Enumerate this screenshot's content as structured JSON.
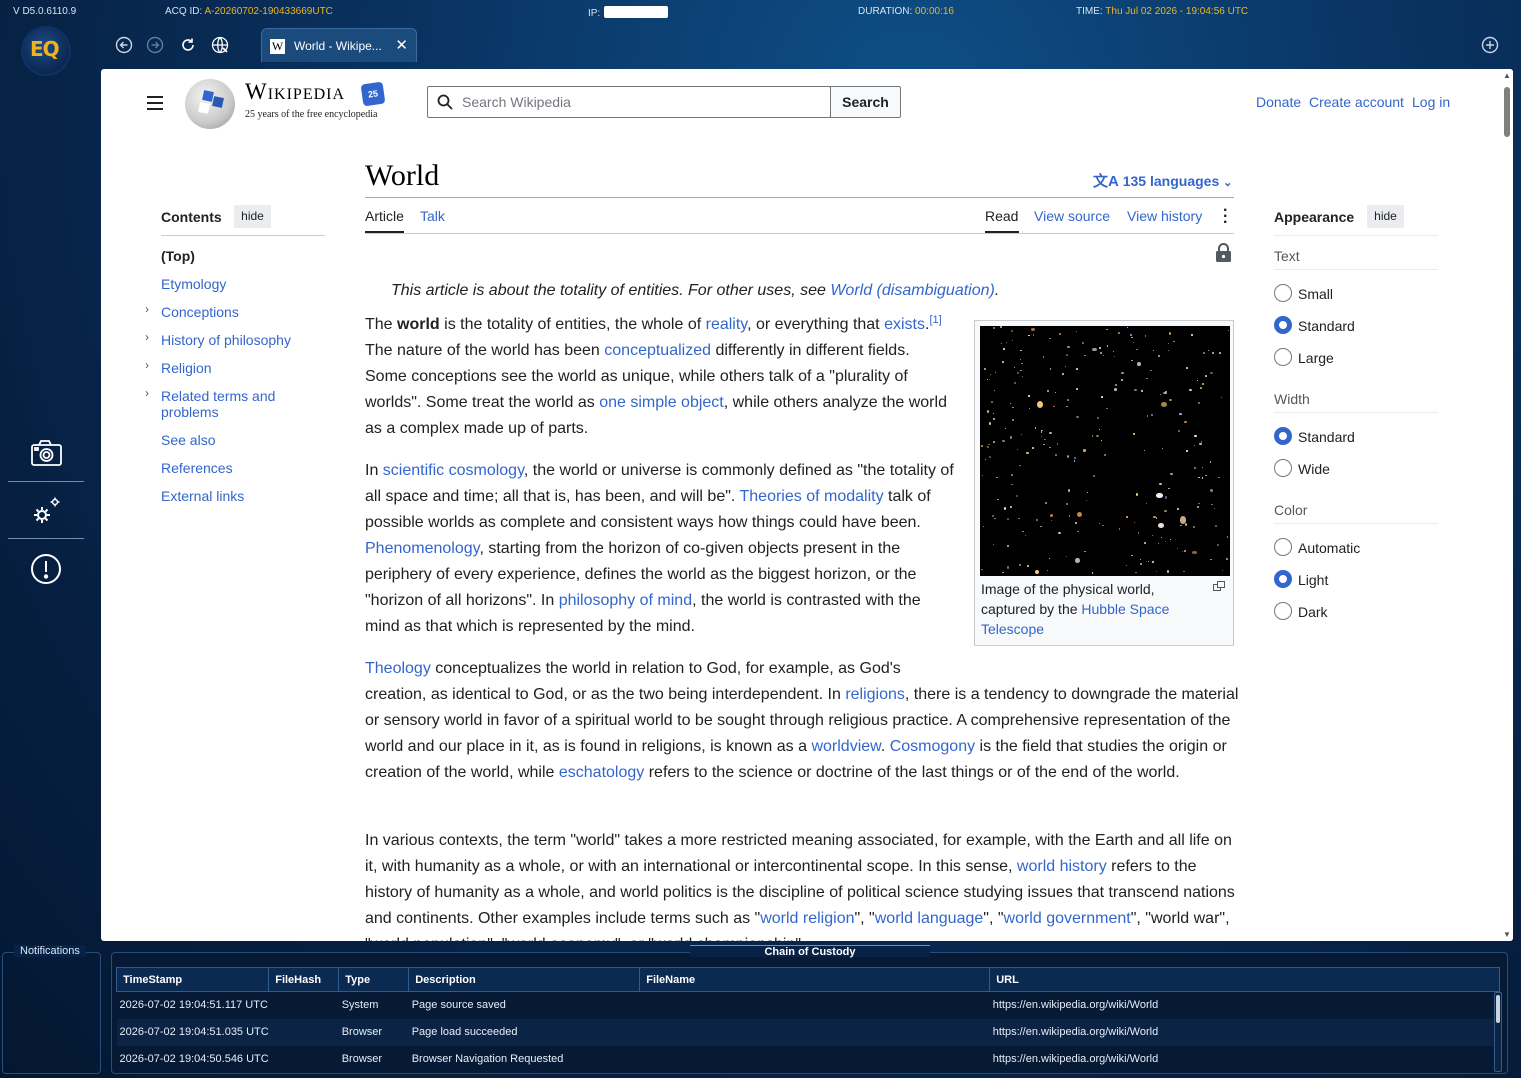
{
  "statusbar": {
    "version": "V D5.0.6110.9",
    "acq_label": "ACQ ID:",
    "acq_value": "A-20260702-190433669UTC",
    "ip_label": "IP:",
    "duration_label": "DURATION:",
    "duration_value": "00:00:16",
    "time_label": "TIME:",
    "time_value": "Thu Jul 02 2026 - 19:04:56 UTC"
  },
  "app": {
    "logo_text": "EQ"
  },
  "browser": {
    "tab_title": "World - Wikipe...",
    "tab_icon": "W",
    "close_glyph": "✕"
  },
  "wiki": {
    "wordmark": "Wikipedia",
    "tagline": "25 years of the free encyclopedia",
    "badge": "25",
    "search_placeholder": "Search Wikipedia",
    "search_button": "Search",
    "donate": "Donate",
    "create_account": "Create account",
    "log_in": "Log in"
  },
  "toc": {
    "heading": "Contents",
    "hide": "hide",
    "items": [
      "(Top)",
      "Etymology",
      "Conceptions",
      "History of philosophy",
      "Religion",
      "Related terms and problems",
      "See also",
      "References",
      "External links"
    ]
  },
  "article": {
    "title": "World",
    "languages": "135 languages",
    "tabs": {
      "article": "Article",
      "talk": "Talk",
      "read": "Read",
      "view_source": "View source",
      "view_history": "View history"
    },
    "hatnote_text": "This article is about the totality of entities. For other uses, see ",
    "hatnote_link": "World (disambiguation)",
    "hatnote_end": ".",
    "caption_a": "Image of the physical world, captured by the ",
    "caption_link": "Hubble Space Telescope"
  },
  "appearance": {
    "heading": "Appearance",
    "hide": "hide",
    "text_label": "Text",
    "text_options": [
      "Small",
      "Standard",
      "Large"
    ],
    "text_selected": "Standard",
    "width_label": "Width",
    "width_options": [
      "Standard",
      "Wide"
    ],
    "width_selected": "Standard",
    "color_label": "Color",
    "color_options": [
      "Automatic",
      "Light",
      "Dark"
    ],
    "color_selected": "Light"
  },
  "notifications": {
    "label": "Notifications"
  },
  "custody": {
    "title": "Chain of Custody",
    "columns": [
      "TimeStamp",
      "FileHash",
      "Type",
      "Description",
      "FileName",
      "URL"
    ],
    "rows": [
      [
        "2026-07-02 19:04:51.117 UTC",
        "",
        "System",
        "Page source saved",
        "",
        "https://en.wikipedia.org/wiki/World"
      ],
      [
        "2026-07-02 19:04:51.035 UTC",
        "",
        "Browser",
        "Page load succeeded",
        "",
        "https://en.wikipedia.org/wiki/World"
      ],
      [
        "2026-07-02 19:04:50.546 UTC",
        "",
        "Browser",
        "Browser Navigation Requested",
        "",
        "https://en.wikipedia.org/wiki/World"
      ]
    ]
  },
  "colors": {
    "accent": "#f0b31e",
    "link": "#3366cc",
    "bg": "#0a3565"
  }
}
